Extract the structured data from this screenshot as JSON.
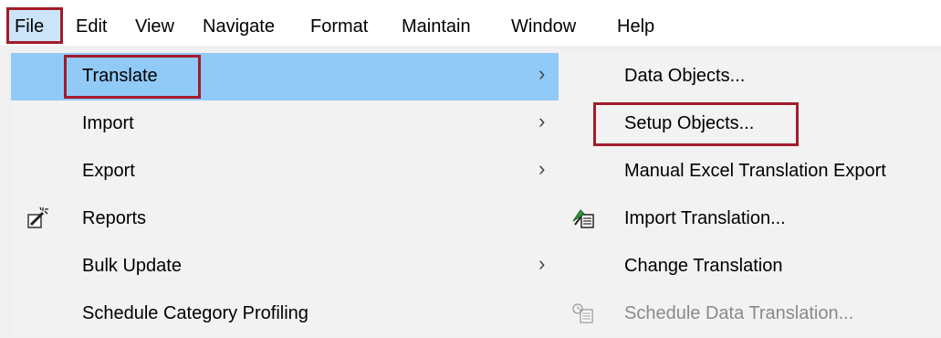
{
  "menubar": {
    "items": [
      "File",
      "Edit",
      "View",
      "Navigate",
      "Format",
      "Maintain",
      "Window",
      "Help"
    ]
  },
  "file_menu": {
    "items": [
      {
        "label": "Translate",
        "submenu": true,
        "highlighted": true
      },
      {
        "label": "Import",
        "submenu": true
      },
      {
        "label": "Export",
        "submenu": true
      },
      {
        "label": "Reports",
        "icon": "wand-icon"
      },
      {
        "label": "Bulk Update",
        "submenu": true
      },
      {
        "label": "Schedule Category Profiling"
      }
    ]
  },
  "translate_submenu": {
    "items": [
      {
        "label": "Data Objects..."
      },
      {
        "label": "Setup Objects..."
      },
      {
        "label": "Manual Excel Translation Export"
      },
      {
        "label": "Import Translation...",
        "icon": "import-translation-icon"
      },
      {
        "label": "Change Translation"
      },
      {
        "label": "Schedule Data Translation...",
        "icon": "schedule-translation-icon",
        "disabled": true
      }
    ]
  },
  "glyphs": {
    "chevron": "›"
  },
  "colors": {
    "highlight": "#91c9f7",
    "callout_border": "#a31c2a",
    "disabled_text": "#8a8a8a"
  }
}
